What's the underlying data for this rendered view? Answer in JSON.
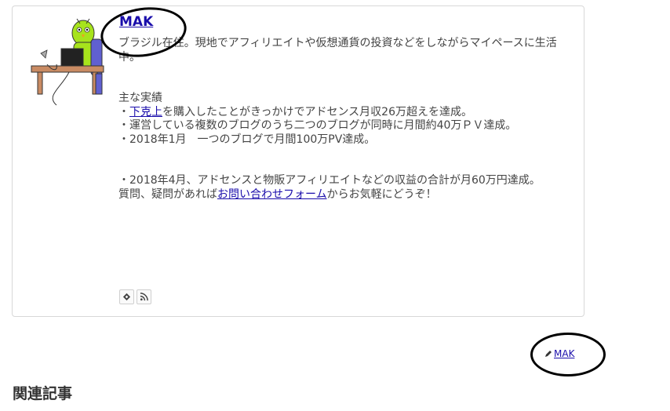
{
  "author": {
    "name": "MAK",
    "bio_line1": "ブラジル在住。現地でアフィリエイトや仮想通貨の投資などをしながらマイペースに生活中。",
    "achievements_heading": "主な実績",
    "achievement1_link": "下克上",
    "achievement1_text": "を購入したことがきっかけでアドセンス月収26万超えを達成。",
    "achievement2": "・運営している複数のブログのうち二つのブログが同時に月間約40万ＰＶ達成。",
    "achievement3": "・2018年1月　一つのブログで月間100万PV達成。",
    "achievement4": "・2018年4月、アドセンスと物販アフィリエイトなどの収益の合計が月60万円達成。",
    "contact_prefix": "質問、疑問があれば",
    "contact_link": "お問い合わせフォーム",
    "contact_suffix": "からお気軽にどうぞ！",
    "bullet": "・"
  },
  "social_icons": [
    "feedly-icon",
    "rss-icon"
  ],
  "post_author": {
    "name": "MAK",
    "icon": "pencil-icon"
  },
  "related": {
    "heading": "関連記事"
  }
}
